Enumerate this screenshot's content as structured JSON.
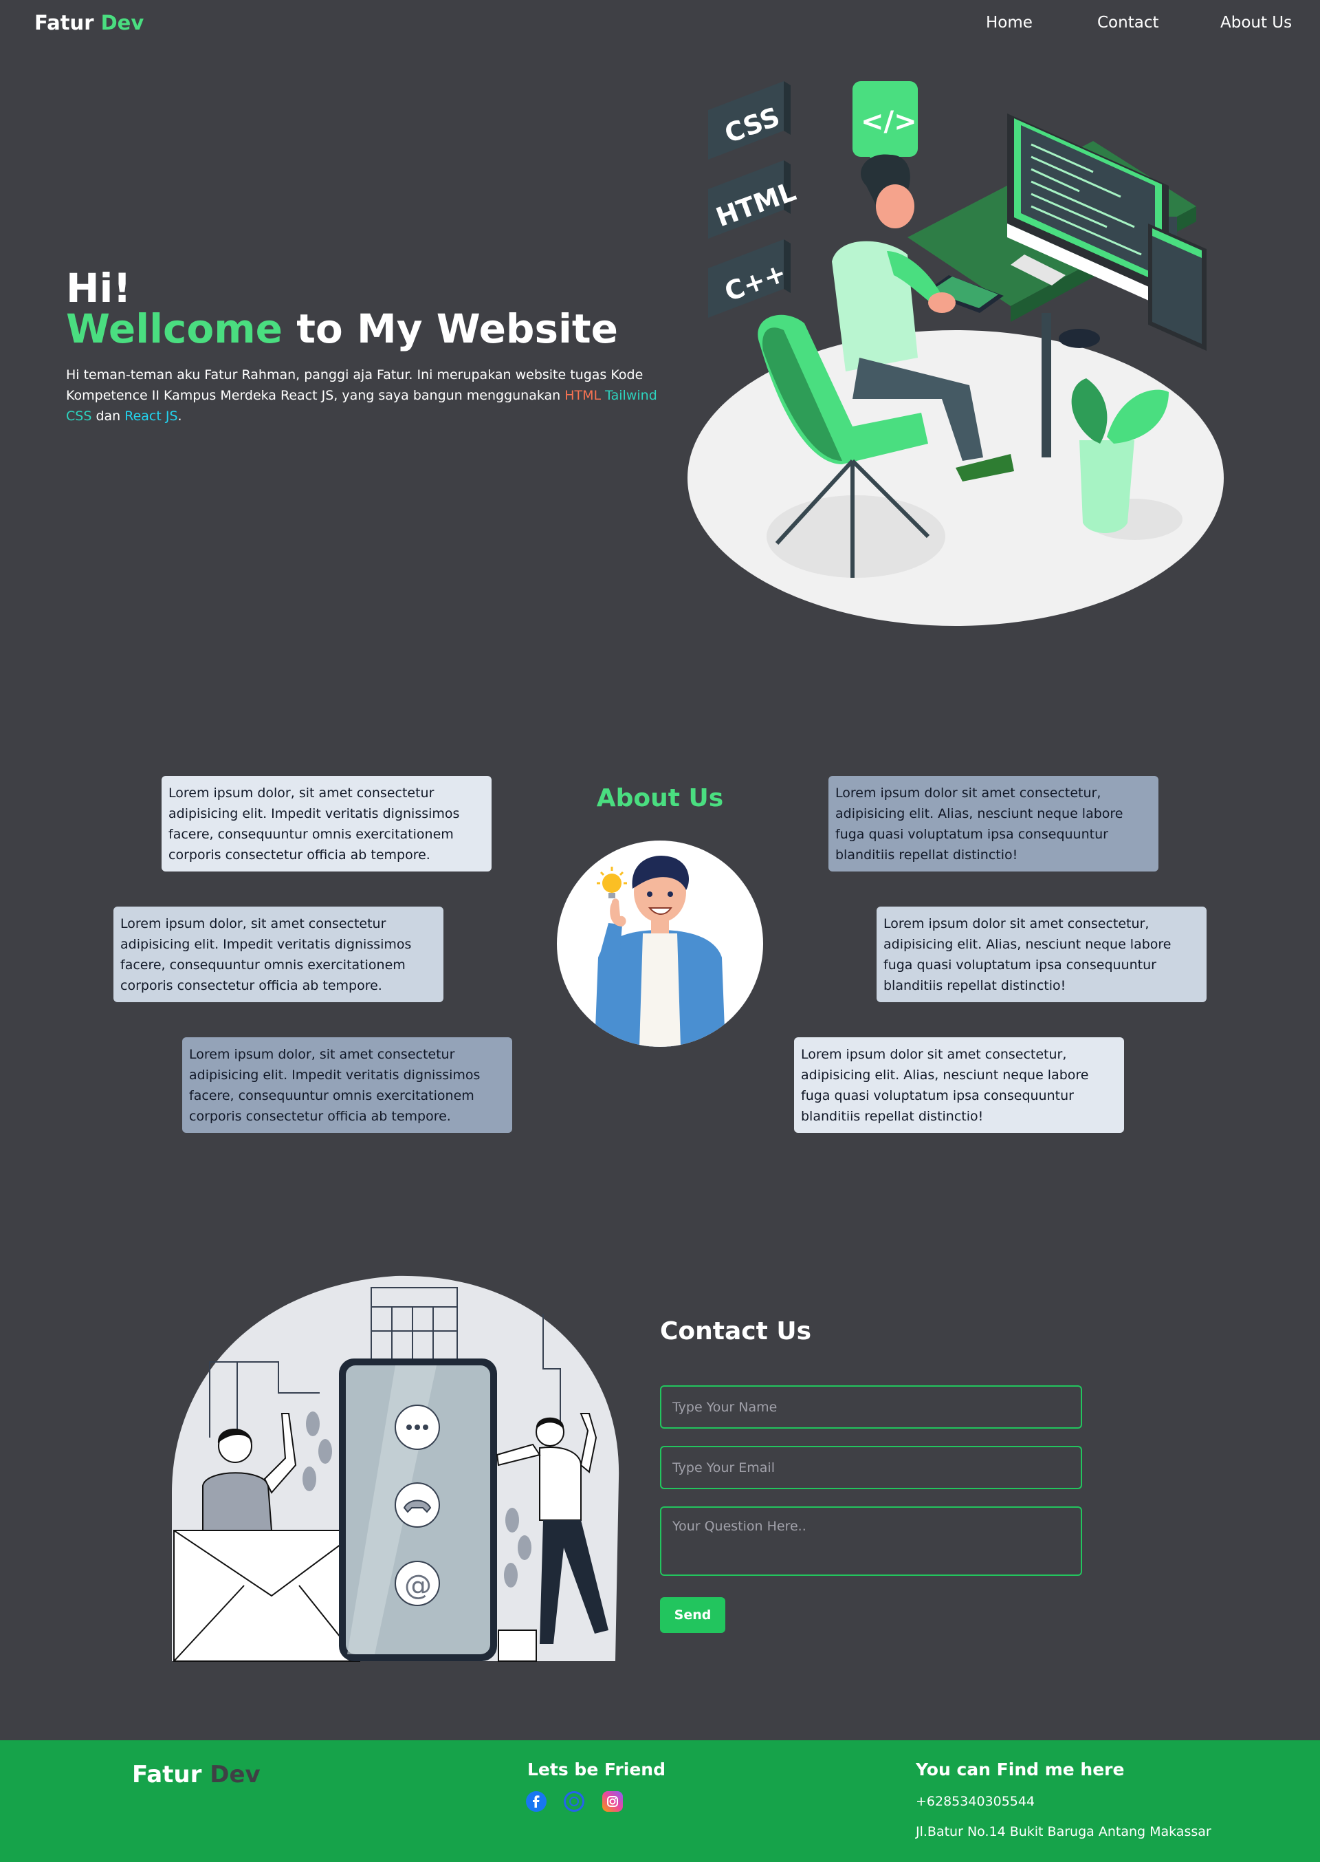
{
  "nav": {
    "brand_main": "Fatur",
    "brand_accent": "Dev",
    "links": [
      "Home",
      "Contact",
      "About Us"
    ]
  },
  "hero": {
    "greeting": "Hi!",
    "welcome_accent": "Wellcome",
    "welcome_rest": " to My Website",
    "desc_part1": "Hi teman-teman aku Fatur Rahman, panggi aja Fatur. Ini merupakan website tugas Kode Kompetence II Kampus Merdeka React JS, yang saya bangun menggunakan ",
    "html": "HTML",
    "tailwind": "Tailwind CSS",
    "desc_and": "dan",
    "react": "React JS",
    "desc_end": ".",
    "illustration_labels": [
      "CSS",
      "HTML",
      "C++",
      "</>"
    ]
  },
  "about": {
    "title": "About Us",
    "cards_left": [
      "Lorem ipsum dolor, sit amet consectetur adipisicing elit. Impedit veritatis dignissimos facere, consequuntur omnis exercitationem corporis consectetur officia ab tempore.",
      "Lorem ipsum dolor, sit amet consectetur adipisicing elit. Impedit veritatis dignissimos facere, consequuntur omnis exercitationem corporis consectetur officia ab tempore.",
      "Lorem ipsum dolor, sit amet consectetur adipisicing elit. Impedit veritatis dignissimos facere, consequuntur omnis exercitationem corporis consectetur officia ab tempore."
    ],
    "cards_right": [
      "Lorem ipsum dolor sit amet consectetur, adipisicing elit. Alias, nesciunt neque labore fuga quasi voluptatum ipsa consequuntur blanditiis repellat distinctio!",
      "Lorem ipsum dolor sit amet consectetur, adipisicing elit. Alias, nesciunt neque labore fuga quasi voluptatum ipsa consequuntur blanditiis repellat distinctio!",
      "Lorem ipsum dolor sit amet consectetur, adipisicing elit. Alias, nesciunt neque labore fuga quasi voluptatum ipsa consequuntur blanditiis repellat distinctio!"
    ]
  },
  "contact": {
    "title": "Contact Us",
    "name_placeholder": "Type Your Name",
    "email_placeholder": "Type Your Email",
    "question_placeholder": "Your Question Here..",
    "send_label": "Send"
  },
  "footer": {
    "brand_main": "Fatur",
    "brand_accent": "Dev",
    "friend_heading": "Lets be Friend",
    "social_icons": [
      "facebook-icon",
      "github-icon",
      "instagram-icon"
    ],
    "find_heading": "You can Find me here",
    "phone": "+6285340305544",
    "address": "Jl.Batur No.14 Bukit Baruga Antang Makassar"
  },
  "colors": {
    "background": "#3f4045",
    "accent": "#4ade80",
    "button": "#22c55e",
    "footer": "#16a34a"
  }
}
